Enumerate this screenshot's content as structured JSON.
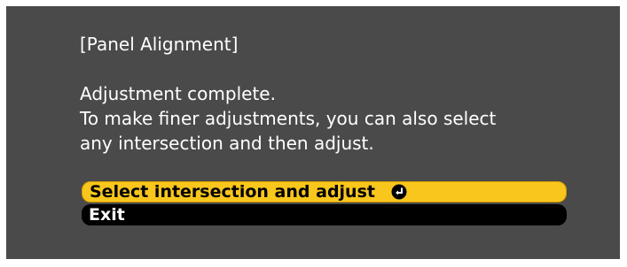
{
  "dialog": {
    "title": "[Panel Alignment]",
    "message_lines": [
      "Adjustment complete.",
      "To make finer adjustments, you can also select",
      "any intersection and then adjust."
    ]
  },
  "menu": {
    "items": [
      {
        "label": "Select intersection and adjust",
        "selected": true,
        "icon": "enter-icon"
      },
      {
        "label": "Exit",
        "selected": false
      }
    ]
  },
  "colors": {
    "screen_background": "#4a4a4a",
    "selected_item": "#f9c61d",
    "normal_item": "#000000",
    "text": "#ffffff"
  }
}
